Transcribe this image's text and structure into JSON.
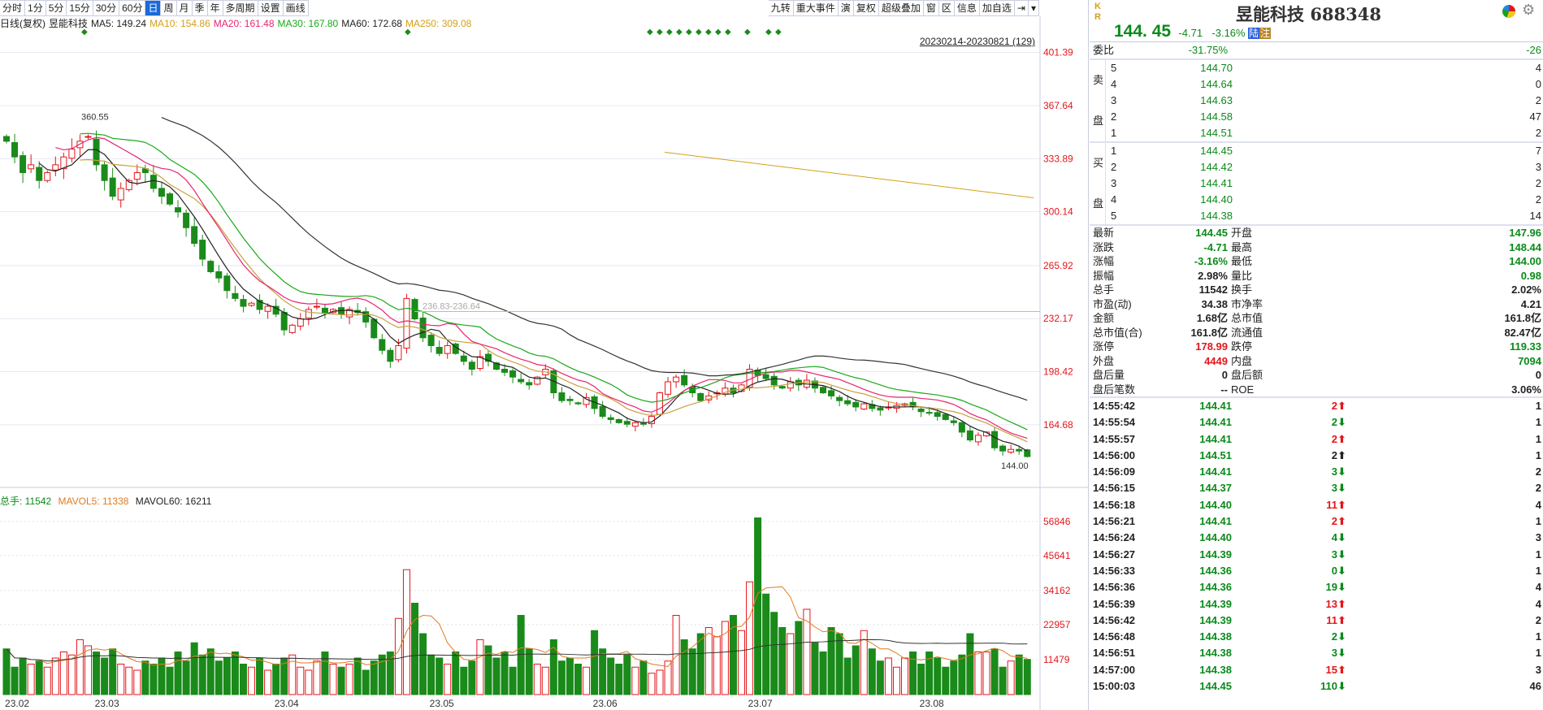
{
  "toolbar": {
    "periods": [
      "分时",
      "1分",
      "5分",
      "15分",
      "30分",
      "60分",
      "日",
      "周",
      "月",
      "季",
      "年",
      "多周期",
      "设置",
      "画线"
    ],
    "active": "日",
    "right_tools": [
      "九转",
      "重大事件",
      "演",
      "复权",
      "超级叠加",
      "窗",
      "区",
      "信息",
      "加自选",
      "⇥",
      "▾"
    ]
  },
  "ma_line": {
    "label": "日线(复权)",
    "name": "昱能科技",
    "items": [
      {
        "t": "MA5: 149.24",
        "c": "#222222"
      },
      {
        "t": "MA10: 154.86",
        "c": "#d4a017"
      },
      {
        "t": "MA20: 161.48",
        "c": "#e8246e"
      },
      {
        "t": "MA30: 167.80",
        "c": "#19a819"
      },
      {
        "t": "MA60: 172.68",
        "c": "#222222"
      },
      {
        "t": "MA250: 309.08",
        "c": "#d4a017"
      }
    ]
  },
  "range_label": "20230214-20230821 (129)",
  "chart_data": [
    {
      "type": "candlestick",
      "y_ticks": [
        "401.39",
        "367.64",
        "333.89",
        "300.14",
        "265.92",
        "232.17",
        "198.42",
        "164.68"
      ],
      "ylim": [
        130,
        410
      ],
      "x_ticks": [
        {
          "label": "23.02",
          "i": 1
        },
        {
          "label": "23.03",
          "i": 12
        },
        {
          "label": "23.04",
          "i": 34
        },
        {
          "label": "23.05",
          "i": 53
        },
        {
          "label": "23.06",
          "i": 73
        },
        {
          "label": "23.07",
          "i": 92
        },
        {
          "label": "23.08",
          "i": 113
        }
      ],
      "annotations": {
        "high": "360.55",
        "low": "144.00",
        "range_line": "236.83-236.64"
      },
      "close": [
        345,
        335,
        325,
        330,
        320,
        325,
        330,
        335,
        340,
        345,
        348,
        330,
        320,
        310,
        315,
        320,
        325,
        325,
        315,
        310,
        305,
        300,
        290,
        280,
        270,
        262,
        258,
        250,
        245,
        240,
        242,
        238,
        240,
        235,
        225,
        228,
        232,
        238,
        240,
        236,
        238,
        235,
        238,
        236,
        230,
        220,
        212,
        205,
        215,
        245,
        232,
        220,
        215,
        210,
        215,
        210,
        205,
        200,
        208,
        205,
        200,
        198,
        195,
        192,
        190,
        195,
        200,
        185,
        180,
        180,
        178,
        182,
        175,
        170,
        168,
        166,
        165,
        166,
        165,
        170,
        185,
        192,
        195,
        190,
        185,
        180,
        183,
        185,
        188,
        185,
        190,
        200,
        196,
        194,
        190,
        188,
        192,
        190,
        193,
        188,
        185,
        183,
        180,
        178,
        176,
        178,
        175,
        174,
        176,
        177,
        178,
        176,
        173,
        172,
        170,
        168,
        166,
        160,
        155,
        158,
        160,
        150,
        148,
        149,
        148,
        144.45
      ],
      "ma250": [
        338,
        309
      ],
      "colors": {
        "up": "#e4161b",
        "down": "#1a8a1a",
        "ma5": "#222222",
        "ma10": "#c8a040",
        "ma20": "#e8246e",
        "ma30": "#19a819",
        "ma60": "#333333",
        "ma250": "#d4a017"
      }
    },
    {
      "type": "bar",
      "header": {
        "total": "总手: 11542",
        "mavol5": "MAVOL5: 11338",
        "mavol60": "MAVOL60: 16211"
      },
      "y_ticks": [
        "56846",
        "45641",
        "34162",
        "22957",
        "11479"
      ],
      "ylim": [
        0,
        60000
      ],
      "volume": [
        15000,
        9000,
        12000,
        10000,
        11000,
        9000,
        12000,
        14000,
        13000,
        18000,
        16000,
        14000,
        12000,
        15000,
        10000,
        9000,
        8000,
        11000,
        10000,
        12000,
        9000,
        14000,
        11000,
        17000,
        13000,
        15000,
        11000,
        12000,
        14000,
        10000,
        9000,
        12000,
        8000,
        10000,
        12000,
        13000,
        9000,
        8000,
        11000,
        14000,
        10000,
        9000,
        10000,
        12000,
        8000,
        11000,
        13000,
        14000,
        25000,
        41000,
        30000,
        20000,
        13000,
        12000,
        10000,
        14000,
        9000,
        11000,
        18000,
        16000,
        12000,
        14000,
        9000,
        26000,
        15000,
        10000,
        9000,
        18000,
        11000,
        12000,
        10000,
        9000,
        21000,
        15000,
        12000,
        10000,
        13000,
        9000,
        11000,
        7000,
        8000,
        11000,
        26000,
        18000,
        15000,
        20000,
        22000,
        19000,
        24000,
        26000,
        21000,
        37000,
        58000,
        33000,
        27000,
        22000,
        20000,
        24000,
        28000,
        17000,
        14000,
        22000,
        20000,
        12000,
        16000,
        21000,
        15000,
        11000,
        12000,
        9000,
        12000,
        14000,
        10000,
        14000,
        12000,
        9000,
        11000,
        13000,
        20000,
        14000,
        14000,
        15000,
        9000,
        11000,
        13000,
        11542
      ]
    }
  ],
  "panel": {
    "badge": [
      "K",
      "R"
    ],
    "name": "昱能科技",
    "code": "688348",
    "price": "144. 45",
    "change": "-4.71",
    "pct": "-3.16%",
    "tags": [
      "陆",
      "注"
    ],
    "weibi": {
      "label": "委比",
      "pct": "-31.75%",
      "diff": "-26"
    },
    "sell_label": [
      "卖",
      "盘"
    ],
    "buy_label": [
      "买",
      "盘"
    ],
    "sell": [
      {
        "n": "5",
        "p": "144.70",
        "v": "4"
      },
      {
        "n": "4",
        "p": "144.64",
        "v": "0"
      },
      {
        "n": "3",
        "p": "144.63",
        "v": "2"
      },
      {
        "n": "2",
        "p": "144.58",
        "v": "47"
      },
      {
        "n": "1",
        "p": "144.51",
        "v": "2"
      }
    ],
    "buy": [
      {
        "n": "1",
        "p": "144.45",
        "v": "7"
      },
      {
        "n": "2",
        "p": "144.42",
        "v": "3"
      },
      {
        "n": "3",
        "p": "144.41",
        "v": "2"
      },
      {
        "n": "4",
        "p": "144.40",
        "v": "2"
      },
      {
        "n": "5",
        "p": "144.38",
        "v": "14"
      }
    ],
    "stats": [
      [
        "最新",
        "144.45",
        "g",
        "开盘",
        "147.96",
        "g"
      ],
      [
        "涨跌",
        "-4.71",
        "g",
        "最高",
        "148.44",
        "g"
      ],
      [
        "涨幅",
        "-3.16%",
        "g",
        "最低",
        "144.00",
        "g"
      ],
      [
        "振幅",
        "2.98%",
        "k",
        "量比",
        "0.98",
        "g"
      ],
      [
        "总手",
        "11542",
        "k",
        "换手",
        "2.02%",
        "k"
      ],
      [
        "市盈(动)",
        "34.38",
        "k",
        "市净率",
        "4.21",
        "k"
      ],
      [
        "金额",
        "1.68亿",
        "k",
        "总市值",
        "161.8亿",
        "k"
      ],
      [
        "总市值(合)",
        "161.8亿",
        "k",
        "流通值",
        "82.47亿",
        "k"
      ],
      [
        "涨停",
        "178.99",
        "r",
        "跌停",
        "119.33",
        "g"
      ],
      [
        "外盘",
        "4449",
        "r",
        "内盘",
        "7094",
        "g"
      ],
      [
        "盘后量",
        "0",
        "k",
        "盘后额",
        "0",
        "k"
      ],
      [
        "盘后笔数",
        "--",
        "k",
        "ROE",
        "3.06%",
        "k"
      ]
    ],
    "trades": [
      [
        "14:55:42",
        "144.41",
        "2",
        "up",
        "1"
      ],
      [
        "14:55:54",
        "144.41",
        "2",
        "down",
        "1"
      ],
      [
        "14:55:57",
        "144.41",
        "2",
        "up",
        "1"
      ],
      [
        "14:56:00",
        "144.51",
        "2",
        "neutral",
        "1"
      ],
      [
        "14:56:09",
        "144.41",
        "3",
        "down",
        "2"
      ],
      [
        "14:56:15",
        "144.37",
        "3",
        "down",
        "2"
      ],
      [
        "14:56:18",
        "144.40",
        "11",
        "up",
        "4"
      ],
      [
        "14:56:21",
        "144.41",
        "2",
        "up",
        "1"
      ],
      [
        "14:56:24",
        "144.40",
        "4",
        "down",
        "3"
      ],
      [
        "14:56:27",
        "144.39",
        "3",
        "down",
        "1"
      ],
      [
        "14:56:33",
        "144.36",
        "0",
        "down",
        "1"
      ],
      [
        "14:56:36",
        "144.36",
        "19",
        "down",
        "4"
      ],
      [
        "14:56:39",
        "144.39",
        "13",
        "up",
        "4"
      ],
      [
        "14:56:42",
        "144.39",
        "11",
        "up",
        "2"
      ],
      [
        "14:56:48",
        "144.38",
        "2",
        "down",
        "1"
      ],
      [
        "14:56:51",
        "144.38",
        "3",
        "down",
        "1"
      ],
      [
        "14:57:00",
        "144.38",
        "15",
        "up",
        "3"
      ],
      [
        "15:00:03",
        "144.45",
        "110",
        "down",
        "46"
      ]
    ]
  }
}
